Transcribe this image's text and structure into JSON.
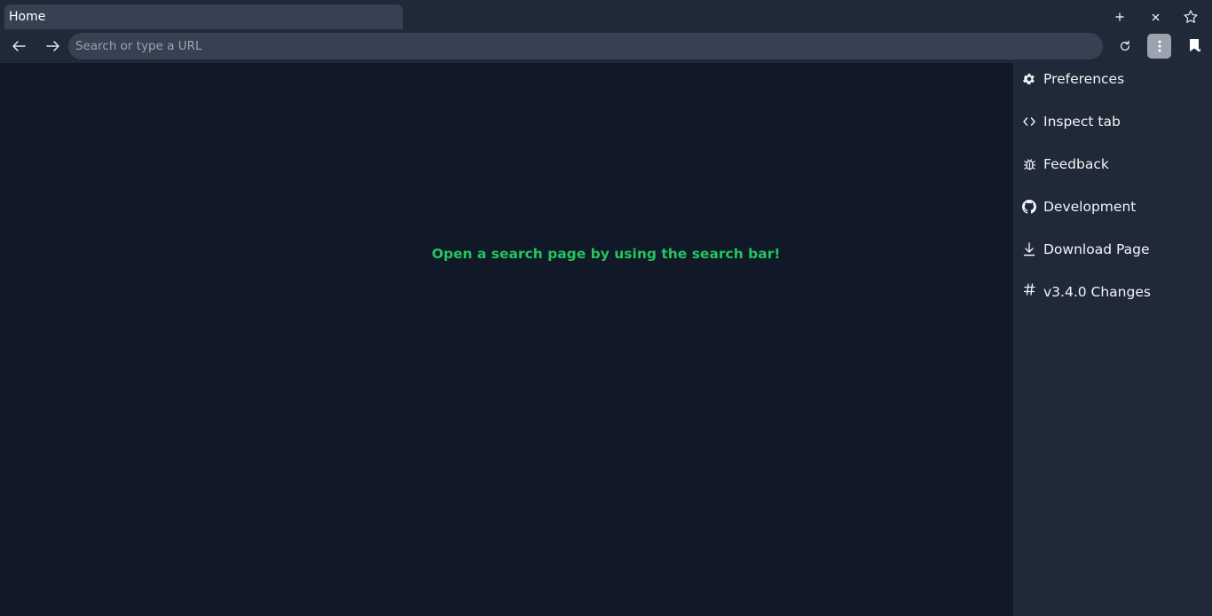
{
  "tab": {
    "title": "Home"
  },
  "tabstrip_icons": [
    "plus-icon",
    "close-icon",
    "star-icon"
  ],
  "toolbar": {
    "url_value": "",
    "url_placeholder": "Search or type a URL",
    "icons": [
      "back-arrow-icon",
      "forward-arrow-icon",
      "reload-icon",
      "kebab-menu-icon",
      "bookmark-icon"
    ]
  },
  "content": {
    "hint": "Open a search page by using the search bar!"
  },
  "menu": {
    "items": [
      {
        "label": "Preferences",
        "icon": "gear-icon"
      },
      {
        "label": "Inspect tab",
        "icon": "code-icon"
      },
      {
        "label": "Feedback",
        "icon": "bug-icon"
      },
      {
        "label": "Development",
        "icon": "github-icon"
      },
      {
        "label": "Download Page",
        "icon": "download-icon"
      },
      {
        "label": "v3.4.0 Changes",
        "icon": "hash-icon"
      }
    ]
  },
  "colors": {
    "background": "#111827",
    "panel": "#1f2937",
    "tab": "#374151",
    "hint_text": "#22c55e",
    "menu_button": "#9ca3af"
  }
}
